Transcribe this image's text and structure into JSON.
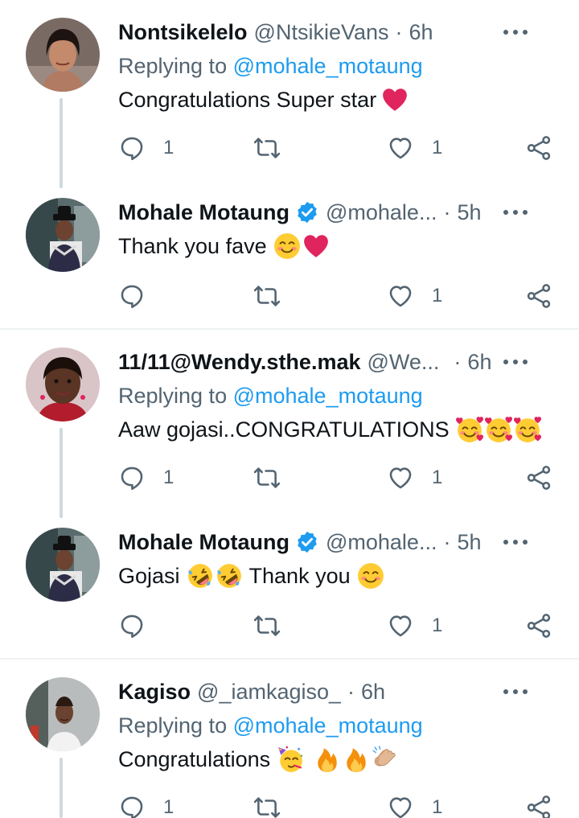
{
  "tweets": [
    {
      "name": "Nontsikelelo",
      "handle": "@NtsikieVans",
      "time": "6h",
      "verified": false,
      "replying_prefix": "Replying to",
      "replying_to": "@mohale_motaung",
      "text": "Congratulations Super star",
      "emojis": [
        "red-heart"
      ],
      "replies": "1",
      "retweets": "",
      "likes": "1"
    },
    {
      "name": "Mohale Motaung",
      "handle": "@mohale...",
      "time": "5h",
      "verified": true,
      "text": "Thank you fave",
      "emojis": [
        "smiling-face-with-smiling-eyes",
        "red-heart"
      ],
      "replies": "",
      "retweets": "",
      "likes": "1"
    },
    {
      "name": "11/11@Wendy.sthe.mak",
      "handle": "@We...",
      "time": "6h",
      "verified": false,
      "replying_prefix": "Replying to",
      "replying_to": "@mohale_motaung",
      "text": "Aaw gojasi..CONGRATULATIONS",
      "emojis": [
        "smiling-face-with-hearts",
        "smiling-face-with-hearts",
        "smiling-face-with-hearts"
      ],
      "replies": "1",
      "retweets": "",
      "likes": "1"
    },
    {
      "name": "Mohale Motaung",
      "handle": "@mohale...",
      "time": "5h",
      "verified": true,
      "text_before": "Gojasi",
      "text_after": "Thank you",
      "emojis": [
        "rolling-on-the-floor-laughing",
        "rolling-on-the-floor-laughing",
        "smiling-face-with-smiling-eyes"
      ],
      "replies": "",
      "retweets": "",
      "likes": "1"
    },
    {
      "name": "Kagiso",
      "handle": "@_iamkagiso_",
      "time": "6h",
      "verified": false,
      "replying_prefix": "Replying to",
      "replying_to": "@mohale_motaung",
      "text": "Congratulations",
      "emojis": [
        "partying-face",
        "fire",
        "fire",
        "clapping-hands-medium-light"
      ],
      "replies": "1",
      "retweets": "",
      "likes": "1"
    }
  ],
  "separator": "·",
  "colors": {
    "text": "#0f1419",
    "secondary": "#536471",
    "link": "#1d9bf0",
    "thread_line": "#cfd9de",
    "divider": "#eff3f4",
    "verified": "#1d9bf0",
    "heart": "#e0245e"
  },
  "icons": {
    "reply": "reply-icon",
    "retweet": "retweet-icon",
    "like": "like-icon",
    "share": "share-icon",
    "more": "more-icon",
    "verified": "verified-badge-icon"
  }
}
